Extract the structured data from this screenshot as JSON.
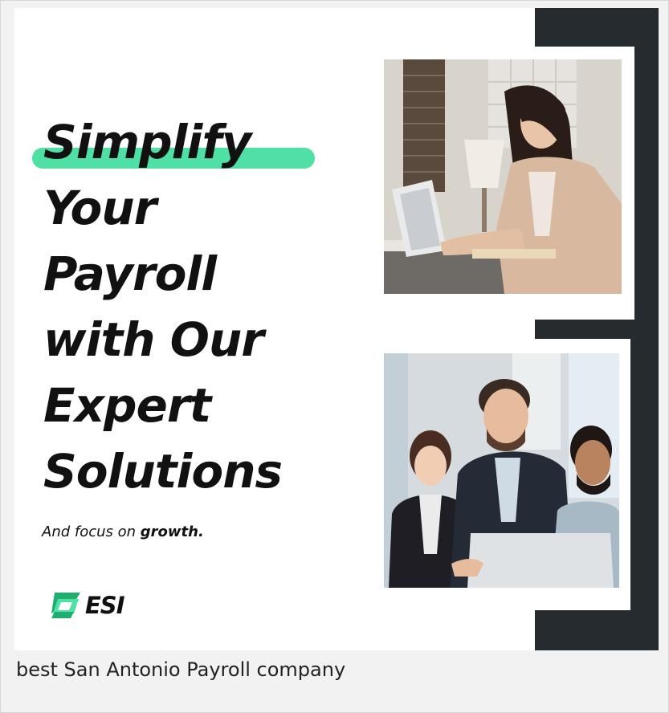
{
  "ad": {
    "headline": {
      "highlight": "Simplify",
      "lines": [
        "Your",
        "Payroll",
        "with Our",
        "Expert",
        "Solutions"
      ]
    },
    "tagline": {
      "prefix": "And focus on ",
      "emphasis": "growth."
    },
    "logo": {
      "text": "ESI",
      "icon": "esi-logo-icon"
    },
    "photos": [
      {
        "name": "woman-working-on-laptop-photo"
      },
      {
        "name": "team-meeting-at-laptop-photo"
      }
    ],
    "colors": {
      "accent": "#4fe0a6",
      "dark_band": "#262b30",
      "text": "#111111"
    }
  },
  "caption": "best San Antonio Payroll company"
}
